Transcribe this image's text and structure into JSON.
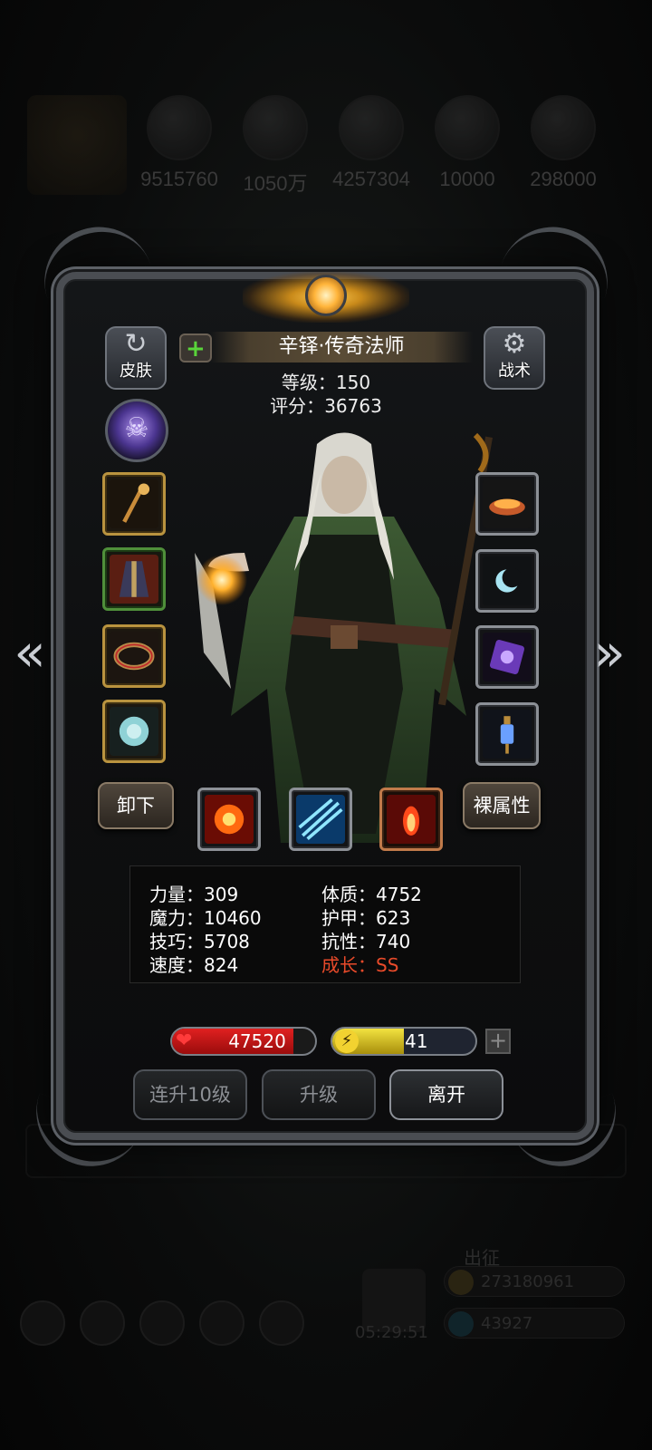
{
  "background": {
    "resources": [
      "9515760",
      "1050万",
      "4257304",
      "10000",
      "298000"
    ],
    "timer": "05:29:51",
    "currency_gold": "273180961",
    "currency_gem": "43927",
    "label_chuzheng": "出征"
  },
  "hero": {
    "name": "辛铎·传奇法师",
    "level_label": "等级：",
    "level": "150",
    "score_label": "评分：",
    "score": "36763"
  },
  "buttons": {
    "skin": "皮肤",
    "tactics": "战术",
    "unequip": "卸下",
    "base_attr": "裸属性",
    "level_up_10": "连升10级",
    "level_up": "升级",
    "leave": "离开"
  },
  "icons": {
    "skin": "shirt-refresh-icon",
    "tactics": "gear-icon",
    "add": "plus-icon",
    "prev": "chevron-left-icon",
    "next": "chevron-right-icon"
  },
  "stats": {
    "strength": "力量：309",
    "magic": "魔力：10460",
    "skill": "技巧：5708",
    "speed": "速度：824",
    "constitution": "体质：4752",
    "armor": "护甲：623",
    "resistance": "抗性：740",
    "growth": "成长：SS"
  },
  "bars": {
    "hp": "47520",
    "hp_fill": 0.85,
    "energy": "41",
    "energy_fill": 0.5
  },
  "colors": {
    "growth": "#e84a2a",
    "hp": "#e02020",
    "energy": "#f2e240"
  }
}
